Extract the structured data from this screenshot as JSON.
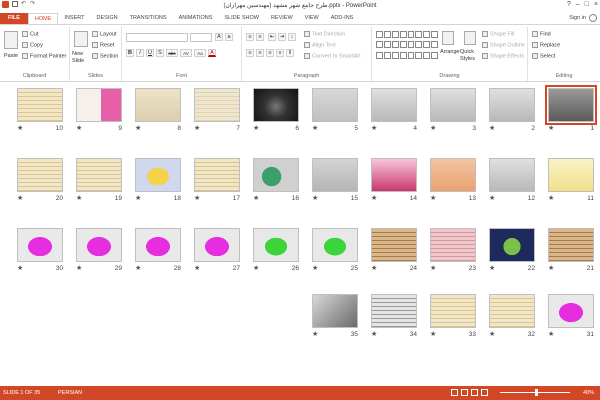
{
  "window": {
    "title": "طرح جامع شهر مشهد (مهندسین مهرازان).pptx - PowerPoint",
    "controls": [
      "?",
      "–",
      "□",
      "×"
    ]
  },
  "tabs": [
    "FILE",
    "HOME",
    "INSERT",
    "DESIGN",
    "TRANSITIONS",
    "ANIMATIONS",
    "SLIDE SHOW",
    "REVIEW",
    "VIEW",
    "ADD-INS"
  ],
  "active_tab": "HOME",
  "sign_in": "Sign in",
  "ribbon": {
    "clipboard": {
      "paste": "Paste",
      "cut": "Cut",
      "copy": "Copy",
      "format_painter": "Format Painter",
      "label": "Clipboard"
    },
    "slides": {
      "new_slide": "New Slide",
      "layout": "Layout",
      "reset": "Reset",
      "section": "Section",
      "label": "Slides"
    },
    "font": {
      "label": "Font",
      "bold": "B",
      "italic": "I",
      "underline": "U",
      "shadow": "S",
      "strike": "abc",
      "spacing": "AV",
      "case": "Aa",
      "color": "A"
    },
    "paragraph": {
      "text_direction": "Text Direction",
      "align_text": "Align Text",
      "convert": "Convert to SmartArt",
      "label": "Paragraph"
    },
    "drawing": {
      "arrange": "Arrange",
      "quick_styles": "Quick Styles",
      "shape_fill": "Shape Fill",
      "shape_outline": "Shape Outline",
      "shape_effects": "Shape Effects",
      "label": "Drawing"
    },
    "editing": {
      "find": "Find",
      "replace": "Replace",
      "select": "Select",
      "label": "Editing"
    }
  },
  "slides": [
    {
      "n": "1",
      "style": "gray-dark"
    },
    {
      "n": "2",
      "style": "gray"
    },
    {
      "n": "3",
      "style": "gray"
    },
    {
      "n": "4",
      "style": "gray"
    },
    {
      "n": "5",
      "style": "gray-yellow"
    },
    {
      "n": "6",
      "style": "dark-photo"
    },
    {
      "n": "7",
      "style": "beige"
    },
    {
      "n": "8",
      "style": "beige-red"
    },
    {
      "n": "9",
      "style": "pink-photo"
    },
    {
      "n": "10",
      "style": "table-beige"
    },
    {
      "n": "11",
      "style": "chart-yellow"
    },
    {
      "n": "12",
      "style": "gray"
    },
    {
      "n": "13",
      "style": "orange-chart"
    },
    {
      "n": "14",
      "style": "pyramid"
    },
    {
      "n": "15",
      "style": "gray-green"
    },
    {
      "n": "16",
      "style": "pie"
    },
    {
      "n": "17",
      "style": "table-beige"
    },
    {
      "n": "18",
      "style": "map-yellow"
    },
    {
      "n": "19",
      "style": "table-beige"
    },
    {
      "n": "20",
      "style": "table-beige"
    },
    {
      "n": "21",
      "style": "table-brown"
    },
    {
      "n": "22",
      "style": "green-dark"
    },
    {
      "n": "23",
      "style": "table-pink"
    },
    {
      "n": "24",
      "style": "table-brown"
    },
    {
      "n": "25",
      "style": "green-map"
    },
    {
      "n": "26",
      "style": "green-map"
    },
    {
      "n": "27",
      "style": "magenta-map"
    },
    {
      "n": "28",
      "style": "magenta-map"
    },
    {
      "n": "29",
      "style": "magenta-map"
    },
    {
      "n": "30",
      "style": "magenta-map"
    },
    {
      "n": "31",
      "style": "magenta-map"
    },
    {
      "n": "32",
      "style": "table-beige"
    },
    {
      "n": "33",
      "style": "table-beige"
    },
    {
      "n": "34",
      "style": "table-gray"
    },
    {
      "n": "35",
      "style": "laptop-photo"
    }
  ],
  "status": {
    "slide_info": "SLIDE 1 OF 35",
    "language": "PERSIAN",
    "zoom": "40%"
  }
}
